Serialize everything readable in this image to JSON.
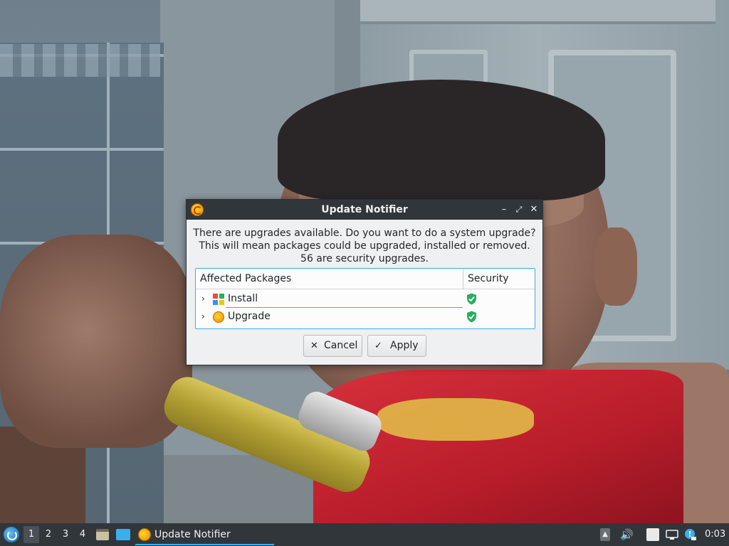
{
  "dialog": {
    "title": "Update Notifier",
    "window_controls": {
      "minimize": "–",
      "maximize": "⤢",
      "close": "✕"
    },
    "message_lines": [
      "There are upgrades available. Do you want to do a system upgrade?",
      "This will mean packages could be upgraded, installed or removed.",
      "56 are security upgrades."
    ],
    "table": {
      "columns": [
        "Affected Packages",
        "Security"
      ],
      "rows": [
        {
          "label": "Install",
          "expander": "›",
          "icon": "install-icon",
          "security": "shield-check-icon"
        },
        {
          "label": "Upgrade",
          "expander": "›",
          "icon": "upgrade-icon",
          "security": "shield-check-icon"
        }
      ]
    },
    "buttons": {
      "cancel": {
        "icon": "✕",
        "label": "Cancel"
      },
      "apply": {
        "icon": "✓",
        "label": "Apply"
      }
    }
  },
  "taskbar": {
    "workspaces": [
      "1",
      "2",
      "3",
      "4"
    ],
    "active_workspace": "1",
    "task": "Update Notifier",
    "tray": {
      "volume": "🔊",
      "notify": "!"
    },
    "clock": "0:03"
  },
  "colors": {
    "titlebar": "#31363b",
    "accent": "#3daee9",
    "shield": "#27ae60"
  }
}
